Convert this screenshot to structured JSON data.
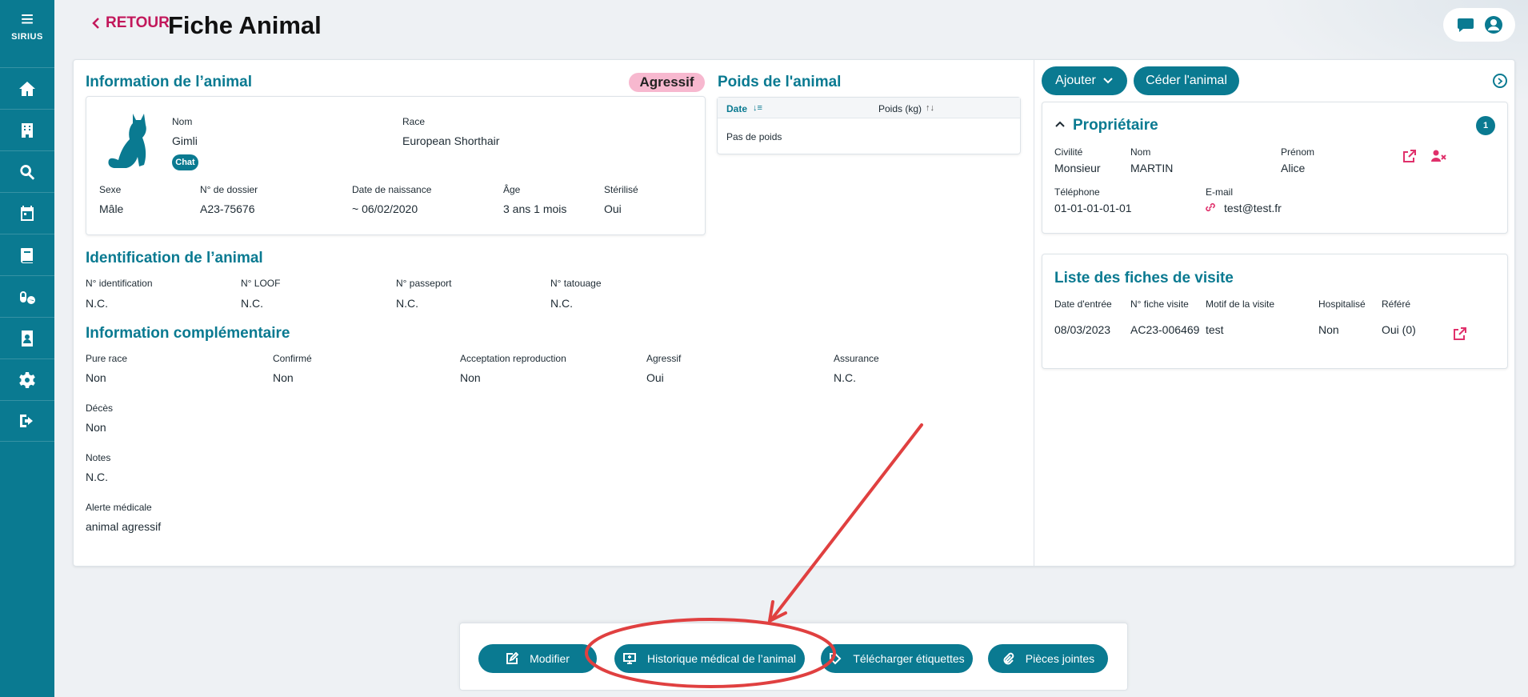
{
  "sidebar": {
    "brand": "SIRIUS",
    "items": [
      {
        "icon": "home-icon"
      },
      {
        "icon": "building-icon"
      },
      {
        "icon": "search-icon"
      },
      {
        "icon": "calendar-icon"
      },
      {
        "icon": "book-icon"
      },
      {
        "icon": "pills-icon"
      },
      {
        "icon": "contact-book-icon"
      },
      {
        "icon": "gear-icon"
      },
      {
        "icon": "logout-icon"
      }
    ]
  },
  "header": {
    "back_label": "RETOUR",
    "title": "Fiche Animal",
    "icons": [
      "chat-bubble-icon",
      "user-icon"
    ]
  },
  "animal_info": {
    "title": "Information de l’animal",
    "aggressive_badge": "Agressif",
    "nom_label": "Nom",
    "nom_value": "Gimli",
    "chat_badge": "Chat",
    "race_label": "Race",
    "race_value": "European Shorthair",
    "sexe_label": "Sexe",
    "sexe_value": "Mâle",
    "dossier_label": "N° de dossier",
    "dossier_value": "A23-75676",
    "naissance_label": "Date de naissance",
    "naissance_value": "~ 06/02/2020",
    "age_label": "Âge",
    "age_value": "3 ans 1 mois",
    "sterilise_label": "Stérilisé",
    "sterilise_value": "Oui"
  },
  "weight": {
    "title": "Poids de l'animal",
    "col_date": "Date",
    "col_poids": "Poids (kg)",
    "empty": "Pas de poids"
  },
  "identification": {
    "title": "Identification de l’animal",
    "fields": [
      {
        "label": "N° identification",
        "value": "N.C."
      },
      {
        "label": "N° LOOF",
        "value": "N.C."
      },
      {
        "label": "N° passeport",
        "value": "N.C."
      },
      {
        "label": "N° tatouage",
        "value": "N.C."
      }
    ]
  },
  "complementary": {
    "title": "Information complémentaire",
    "fields": [
      {
        "label": "Pure race",
        "value": "Non"
      },
      {
        "label": "Confirmé",
        "value": "Non"
      },
      {
        "label": "Acceptation reproduction",
        "value": "Non"
      },
      {
        "label": "Agressif",
        "value": "Oui"
      },
      {
        "label": "Assurance",
        "value": "N.C."
      }
    ],
    "deces_label": "Décès",
    "deces_value": "Non",
    "notes_label": "Notes",
    "notes_value": "N.C.",
    "alerte_label": "Alerte médicale",
    "alerte_value": "animal agressif"
  },
  "right_panel": {
    "add_button": "Ajouter",
    "transfer_button": "Céder l'animal",
    "owner": {
      "title": "Propriétaire",
      "count": "1",
      "civilite_label": "Civilité",
      "civilite_value": "Monsieur",
      "nom_label": "Nom",
      "nom_value": "MARTIN",
      "prenom_label": "Prénom",
      "prenom_value": "Alice",
      "tel_label": "Téléphone",
      "tel_value": "01-01-01-01-01",
      "email_label": "E-mail",
      "email_value": "test@test.fr"
    },
    "visits": {
      "title": "Liste des fiches de visite",
      "columns": [
        "Date d'entrée",
        "N° fiche visite",
        "Motif de la visite",
        "Hospitalisé",
        "Référé"
      ],
      "rows": [
        [
          "08/03/2023",
          "AC23-006469",
          "test",
          "Non",
          "Oui (0)"
        ]
      ]
    }
  },
  "actions": {
    "modifier": "Modifier",
    "historique": "Historique médical de l’animal",
    "etiquettes": "Télécharger étiquettes",
    "pieces": "Pièces jointes"
  },
  "colors": {
    "primary": "#0a7a91",
    "accent_pink": "#c2185b",
    "annotation_red": "#e04040"
  }
}
